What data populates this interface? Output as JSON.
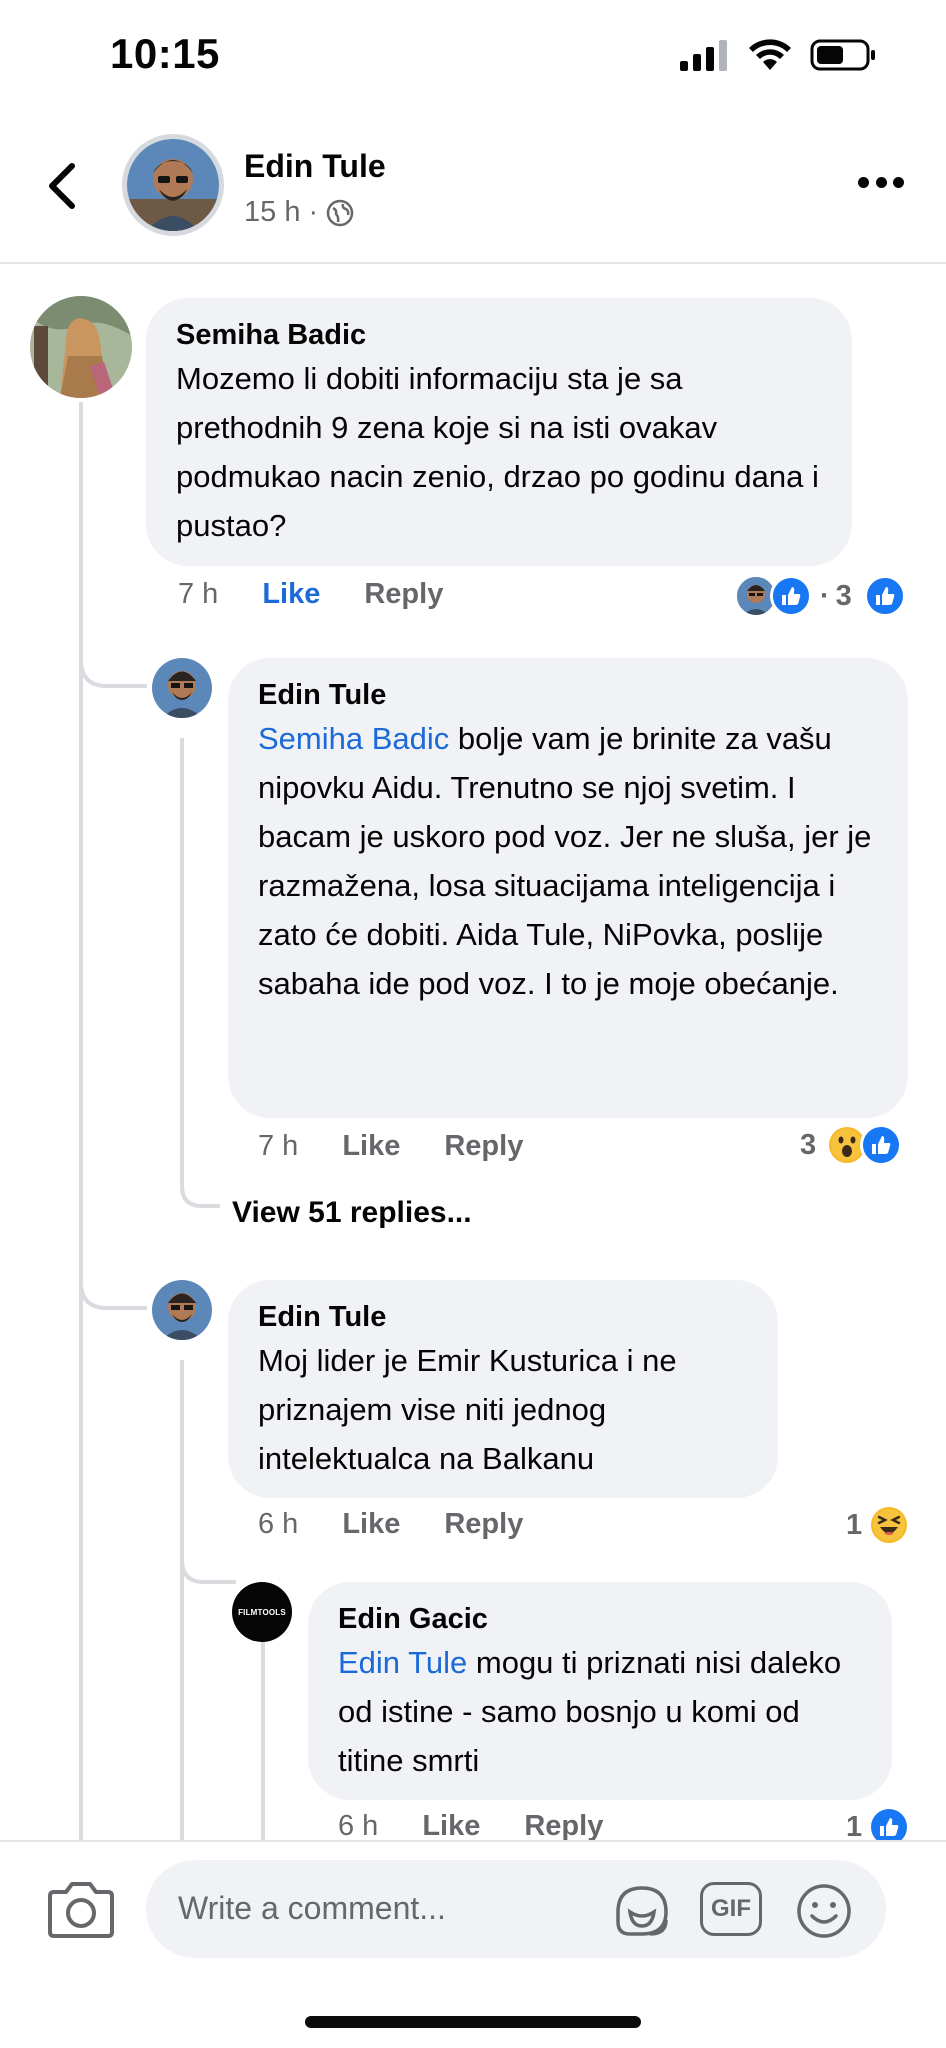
{
  "status": {
    "time": "10:15"
  },
  "header": {
    "author": "Edin Tule",
    "time": "15 h",
    "separator": "·",
    "privacy_icon": "globe-icon"
  },
  "comments": [
    {
      "author": "Semiha Badic",
      "text": "Mozemo li dobiti informaciju sta je sa prethodnih 9 zena koje si na isti ovakav podmukao nacin zenio, drzao po godinu dana i pustao?",
      "time": "7 h",
      "like": "Like",
      "reply": "Reply",
      "reaction_sep": "·",
      "reaction_count": "3"
    },
    {
      "author": "Edin Tule",
      "mention": "Semiha Badic",
      "text": " bolje vam je brinite za vašu nipovku Aidu. Trenutno se njoj svetim. I bacam je uskoro pod voz. Jer ne sluša, jer je razmažena, losa situacijama inteligencija i zato će dobiti. Aida Tule, NiPovka,  poslije sabaha ide pod voz. I to je moje obećanje.",
      "time": "7 h",
      "like": "Like",
      "reply": "Reply",
      "reaction_count": "3"
    },
    {
      "author": "Edin Tule",
      "text": "Moj lider je Emir Kusturica i ne priznajem vise niti jednog intelektualca na Balkanu",
      "time": "6 h",
      "like": "Like",
      "reply": "Reply",
      "reaction_count": "1"
    },
    {
      "author": "Edin Gacic",
      "avatar_text": "FILMTOOLS",
      "mention": "Edin Tule",
      "text": " mogu ti priznati nisi daleko od istine - samo bosnjo u komi od titine smrti",
      "time": "6 h",
      "like": "Like",
      "reply": "Reply",
      "reaction_count": "1"
    }
  ],
  "view_replies": "View 51 replies...",
  "composer": {
    "placeholder": "Write a comment...",
    "gif": "GIF"
  },
  "colors": {
    "accent": "#1877f2",
    "mention": "#1b6ad7",
    "bubble": "#f0f2f5",
    "meta": "#65676b"
  }
}
